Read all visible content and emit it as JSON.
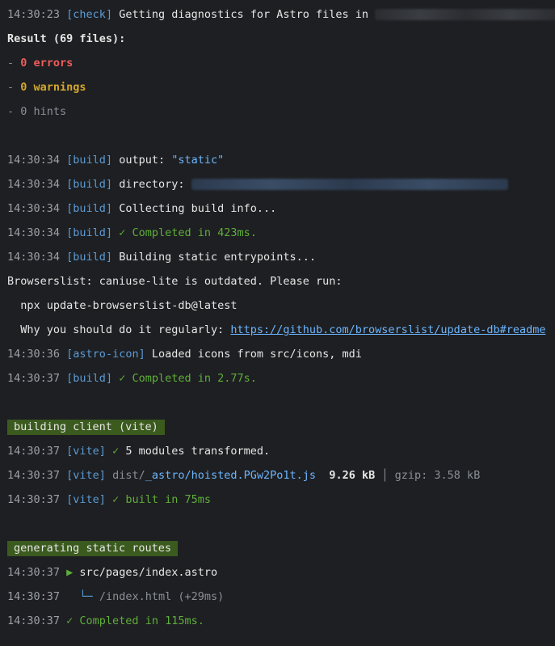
{
  "lines": {
    "check": {
      "ts": "14:30:23",
      "tag": "[check]",
      "text": " Getting diagnostics for Astro files in ",
      "tail": "r"
    },
    "result": "Result (69 files):",
    "errors": {
      "dash": "- ",
      "text": "0 errors"
    },
    "warnings": {
      "dash": "- ",
      "text": "0 warnings"
    },
    "hints": "- 0 hints",
    "output": {
      "ts": "14:30:34",
      "tag": "[build]",
      "label": " output: ",
      "value": "\"static\""
    },
    "directory": {
      "ts": "14:30:34",
      "tag": "[build]",
      "label": " directory: "
    },
    "collecting": {
      "ts": "14:30:34",
      "tag": "[build]",
      "text": " Collecting build info..."
    },
    "completed1": {
      "ts": "14:30:34",
      "tag": "[build]",
      "text": " ✓ Completed in 423ms."
    },
    "entrypoints": {
      "ts": "14:30:34",
      "tag": "[build]",
      "text": " Building static entrypoints..."
    },
    "browserslist1": "Browserslist: caniuse-lite is outdated. Please run:",
    "browserslist2": "  npx update-browserslist-db@latest",
    "browserslist3": {
      "text": "  Why you should do it regularly: ",
      "link": "https://github.com/browserslist/update-db#readme"
    },
    "icons": {
      "ts": "14:30:36",
      "tag": "[astro-icon]",
      "text": " Loaded icons from src/icons, mdi"
    },
    "completed2": {
      "ts": "14:30:37",
      "tag": "[build]",
      "text": " ✓ Completed in 2.77s."
    },
    "section_client": "building client (vite)",
    "transformed": {
      "ts": "14:30:37",
      "tag": "[vite]",
      "check": " ✓ ",
      "text": "5 modules transformed."
    },
    "asset": {
      "ts": "14:30:37",
      "tag": "[vite]",
      "dir": " dist/",
      "file": "_astro/hoisted.PGw2Po1t.js",
      "size": "9.26 kB",
      "sep": "│",
      "gzip": "gzip: 3.58 kB"
    },
    "built": {
      "ts": "14:30:37",
      "tag": "[vite]",
      "text": " ✓ built in 75ms"
    },
    "section_routes": "generating static routes",
    "page": {
      "ts": "14:30:37",
      "arrow": " ▶ ",
      "text": "src/pages/index.astro"
    },
    "route": {
      "ts": "14:30:37",
      "branch": "   └─ ",
      "text": "/index.html (+29ms)"
    },
    "completed3": {
      "ts": "14:30:37",
      "text": " ✓ Completed in 115ms."
    }
  }
}
